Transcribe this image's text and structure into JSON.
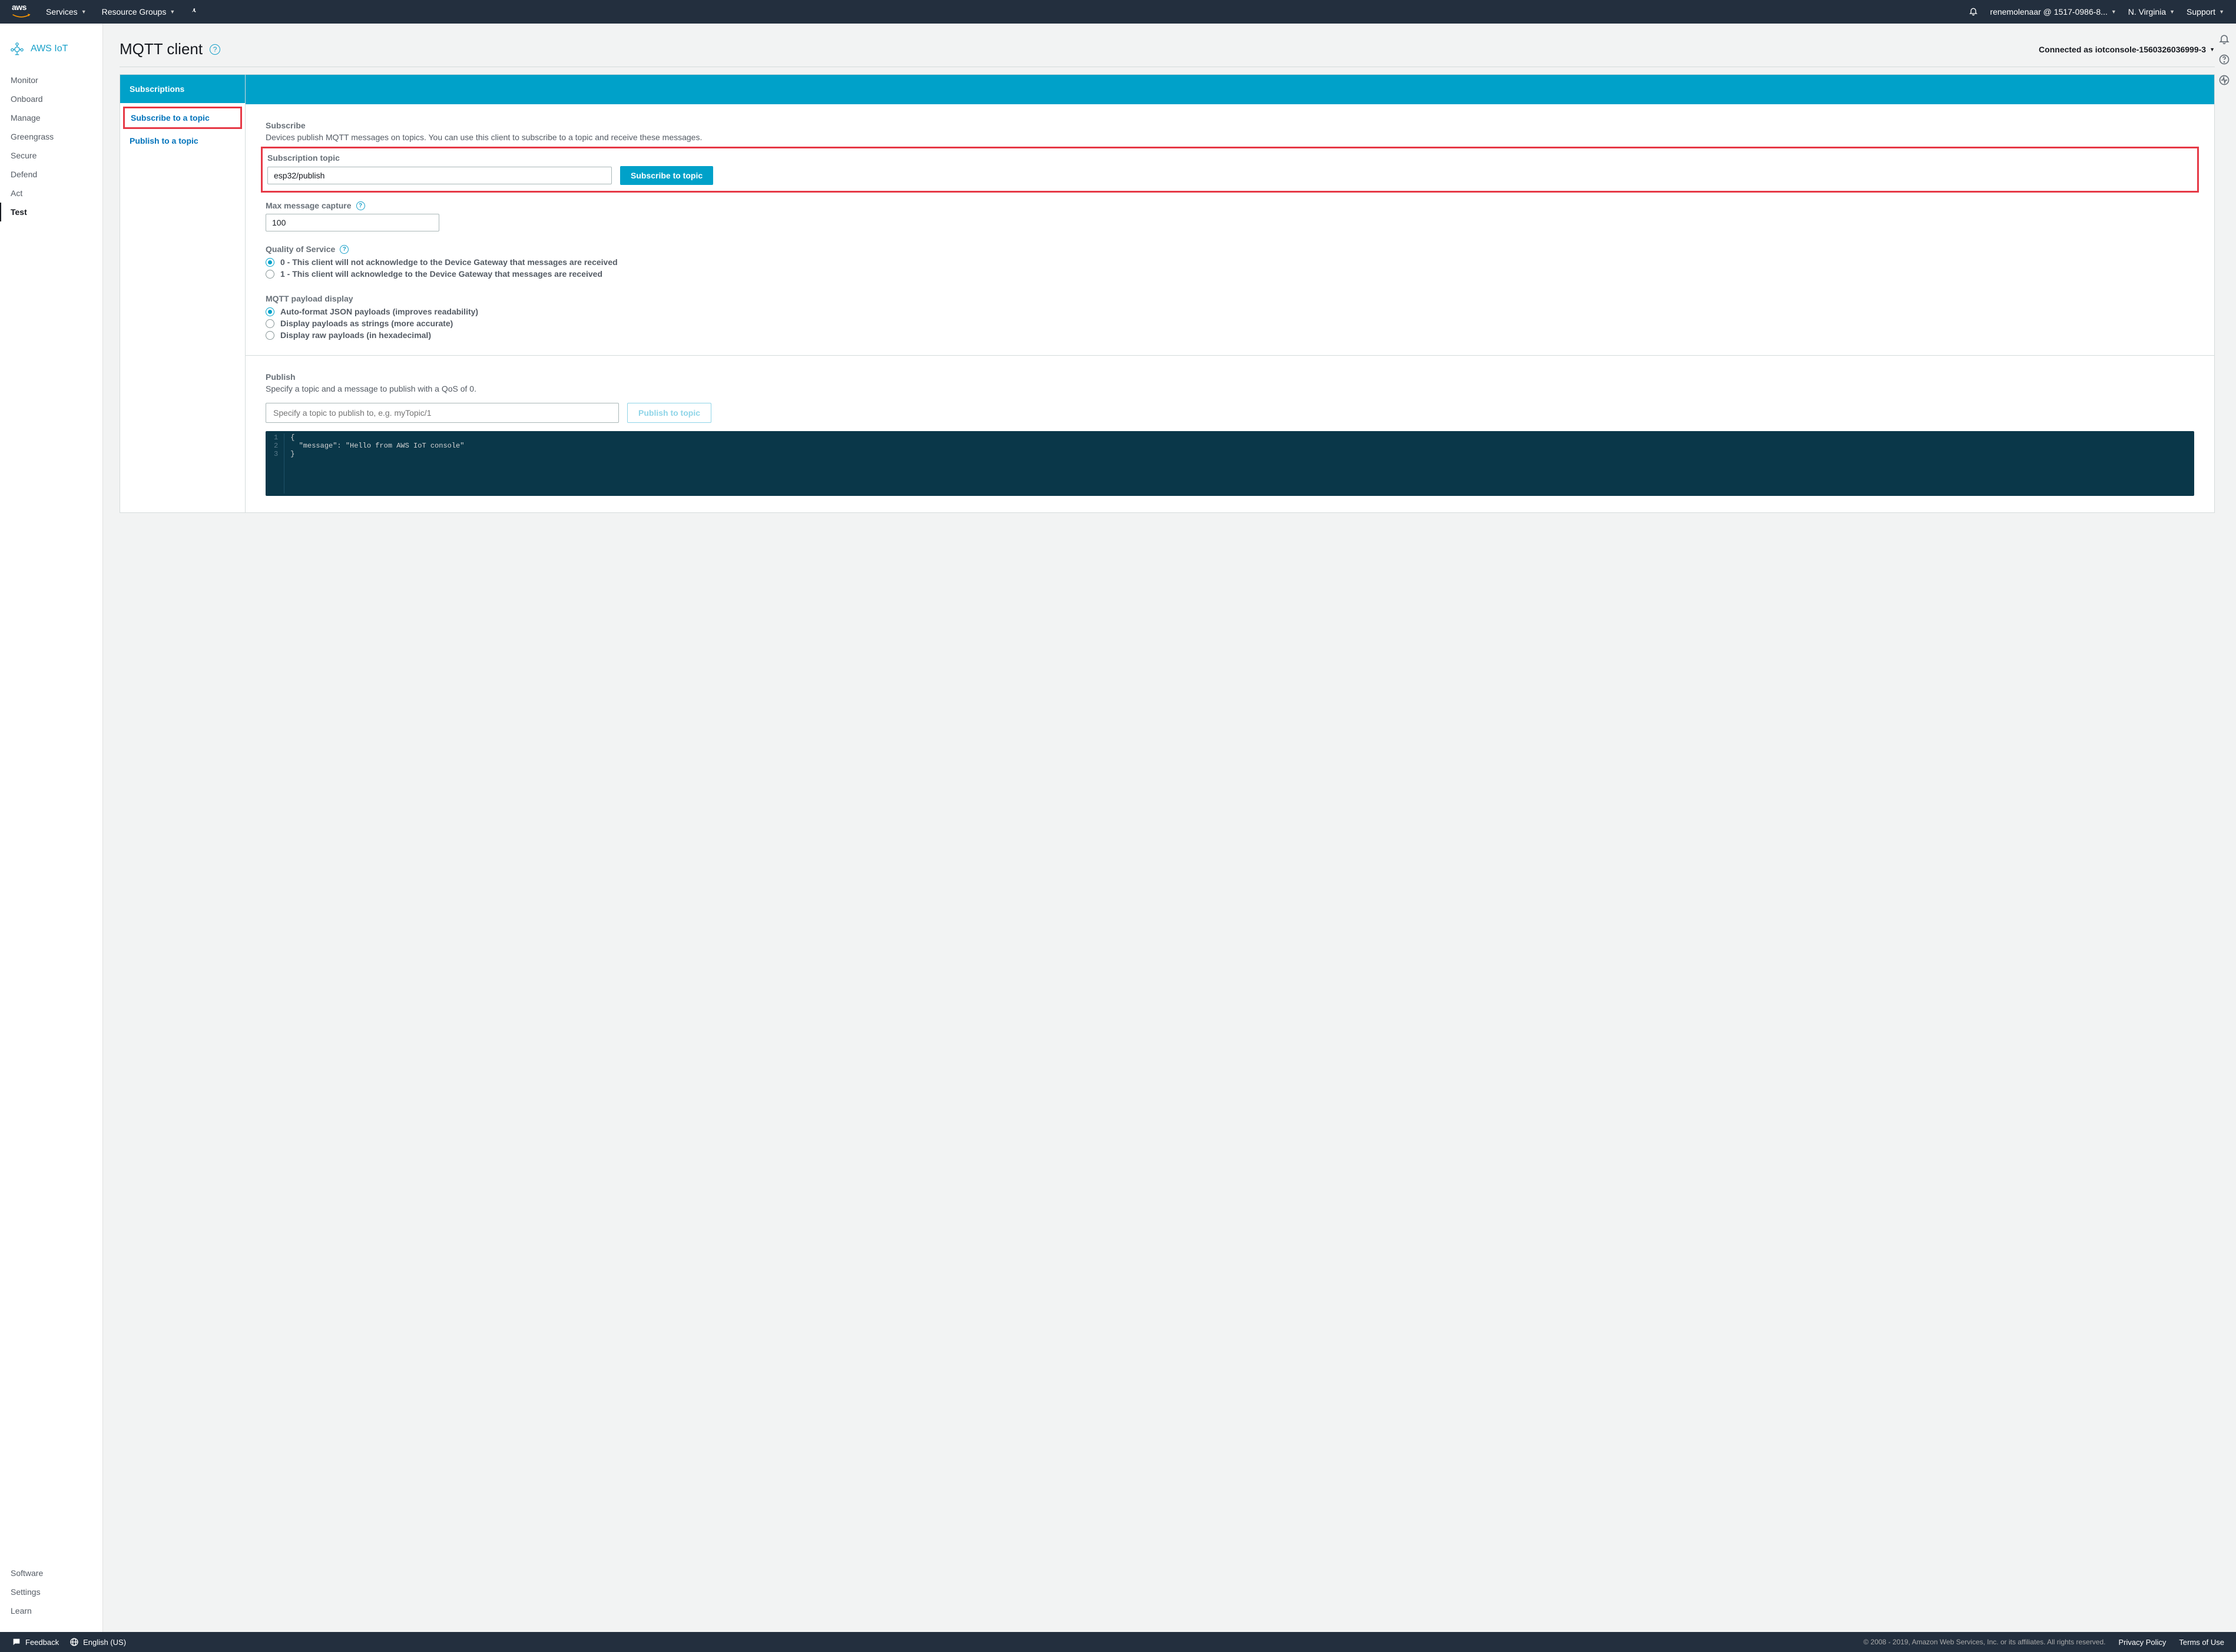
{
  "top_nav": {
    "services_label": "Services",
    "resource_groups_label": "Resource Groups",
    "account_label": "renemolenaar @ 1517-0986-8...",
    "region_label": "N. Virginia",
    "support_label": "Support"
  },
  "sidebar": {
    "brand": "AWS IoT",
    "items": [
      {
        "label": "Monitor",
        "active": false
      },
      {
        "label": "Onboard",
        "active": false
      },
      {
        "label": "Manage",
        "active": false
      },
      {
        "label": "Greengrass",
        "active": false
      },
      {
        "label": "Secure",
        "active": false
      },
      {
        "label": "Defend",
        "active": false
      },
      {
        "label": "Act",
        "active": false
      },
      {
        "label": "Test",
        "active": true
      }
    ],
    "bottom_items": [
      {
        "label": "Software"
      },
      {
        "label": "Settings"
      },
      {
        "label": "Learn"
      }
    ]
  },
  "page": {
    "title": "MQTT client",
    "connection_status": "Connected as iotconsole-1560326036999-3"
  },
  "subscriptions_panel": {
    "header": "Subscriptions",
    "subscribe_link": "Subscribe to a topic",
    "publish_link": "Publish to a topic"
  },
  "subscribe_section": {
    "heading": "Subscribe",
    "description": "Devices publish MQTT messages on topics. You can use this client to subscribe to a topic and receive these messages.",
    "topic_label": "Subscription topic",
    "topic_value": "esp32/publish",
    "subscribe_button": "Subscribe to topic",
    "max_capture_label": "Max message capture",
    "max_capture_value": "100",
    "qos_label": "Quality of Service",
    "qos_options": [
      "0 - This client will not acknowledge to the Device Gateway that messages are received",
      "1 - This client will acknowledge to the Device Gateway that messages are received"
    ],
    "payload_label": "MQTT payload display",
    "payload_options": [
      "Auto-format JSON payloads (improves readability)",
      "Display payloads as strings (more accurate)",
      "Display raw payloads (in hexadecimal)"
    ]
  },
  "publish_section": {
    "heading": "Publish",
    "description": "Specify a topic and a message to publish with a QoS of 0.",
    "topic_placeholder": "Specify a topic to publish to, e.g. myTopic/1",
    "publish_button": "Publish to topic",
    "code_lines": [
      "{",
      "  \"message\": \"Hello from AWS IoT console\"",
      "}"
    ]
  },
  "footer": {
    "feedback": "Feedback",
    "language": "English (US)",
    "copyright": "© 2008 - 2019, Amazon Web Services, Inc. or its affiliates. All rights reserved.",
    "privacy": "Privacy Policy",
    "terms": "Terms of Use"
  }
}
